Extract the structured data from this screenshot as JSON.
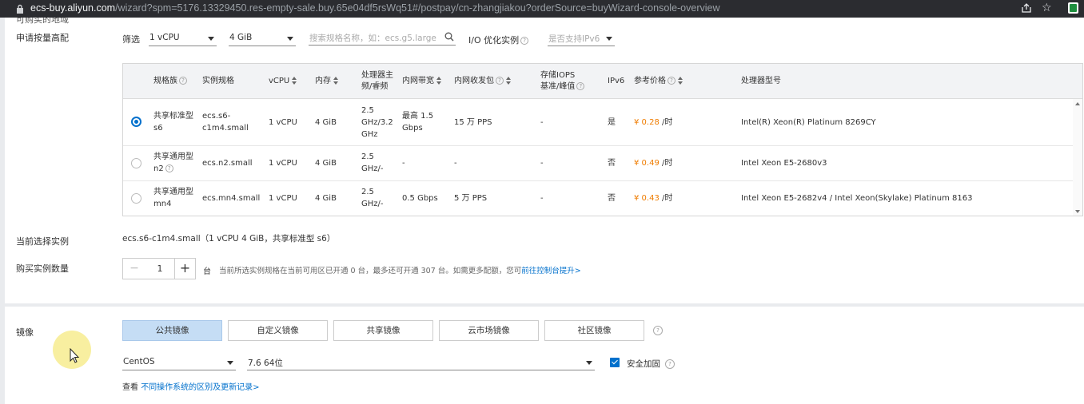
{
  "browser": {
    "url_host": "ecs-buy.aliyun.com",
    "url_path": "/wizard?spm=5176.13329450.res-empty-sale.buy.65e04df5rsWq51#/postpay/cn-zhangjiakou?orderSource=buyWizard-console-overview"
  },
  "top_cut_label": "可购买的地域",
  "filter": {
    "section_label": "申请按量高配",
    "label": "筛选",
    "vcpu_value": "1 vCPU",
    "memory_value": "4 GiB",
    "search_placeholder": "搜索规格名称，如：ecs.g5.large",
    "io_label": "I/O 优化实例",
    "ipv6_placeholder": "是否支持IPv6"
  },
  "table": {
    "headers": {
      "family": "规格族",
      "spec": "实例规格",
      "vcpu": "vCPU",
      "memory": "内存",
      "freq_line1": "处理器主",
      "freq_line2": "频/睿频",
      "bandwidth": "内网带宽",
      "pps": "内网收发包",
      "iops_line1": "存储IOPS",
      "iops_line2": "基准/峰值",
      "ipv6": "IPv6",
      "price": "参考价格",
      "cpu_model": "处理器型号"
    },
    "rows": [
      {
        "selected": true,
        "family_line1": "共享标准型",
        "family_line2": "s6",
        "spec_line1": "ecs.s6-",
        "spec_line2": "c1m4.small",
        "vcpu": "1 vCPU",
        "memory": "4 GiB",
        "freq_line1": "2.5",
        "freq_line2": "GHz/3.2",
        "freq_line3": "GHz",
        "bw_line1": "最高 1.5",
        "bw_line2": "Gbps",
        "pps": "15 万 PPS",
        "iops": "-",
        "ipv6": "是",
        "price": "¥ 0.28",
        "price_unit": " /时",
        "cpu_model": "Intel(R) Xeon(R) Platinum 8269CY"
      },
      {
        "selected": false,
        "family_line1": "共享通用型",
        "family_line2": "n2",
        "spec_line1": "ecs.n2.small",
        "spec_line2": "",
        "vcpu": "1 vCPU",
        "memory": "4 GiB",
        "freq_line1": "2.5",
        "freq_line2": "GHz/-",
        "freq_line3": "",
        "bw_line1": "-",
        "bw_line2": "",
        "pps": "-",
        "iops": "-",
        "ipv6": "否",
        "price": "¥ 0.49",
        "price_unit": " /时",
        "cpu_model": "Intel Xeon E5-2680v3"
      },
      {
        "selected": false,
        "family_line1": "共享通用型",
        "family_line2": "mn4",
        "spec_line1": "ecs.mn4.small",
        "spec_line2": "",
        "vcpu": "1 vCPU",
        "memory": "4 GiB",
        "freq_line1": "2.5",
        "freq_line2": "GHz/-",
        "freq_line3": "",
        "bw_line1": "0.5 Gbps",
        "bw_line2": "",
        "pps": "5 万 PPS",
        "iops": "-",
        "ipv6": "否",
        "price": "¥ 0.43",
        "price_unit": " /时",
        "cpu_model": "Intel Xeon E5-2682v4 / Intel Xeon(Skylake) Platinum 8163"
      }
    ]
  },
  "current": {
    "label": "当前选择实例",
    "value": "ecs.s6-c1m4.small（1 vCPU 4 GiB，共享标准型 s6）"
  },
  "quantity": {
    "label": "购买实例数量",
    "minus": "−",
    "value": "1",
    "plus": "+",
    "unit": "台",
    "hint": "当前所选实例规格在当前可用区已开通 0 台，最多还可开通 307 台。如需更多配额，您可",
    "hint_link": "前往控制台提升>"
  },
  "image": {
    "label": "镜像",
    "tabs": [
      "公共镜像",
      "自定义镜像",
      "共享镜像",
      "云市场镜像",
      "社区镜像"
    ],
    "os_value": "CentOS",
    "version_value": "7.6 64位",
    "hardening_label": "安全加固",
    "footer_prefix": "查看 ",
    "footer_link": "不同操作系统的区别及更新记录>"
  },
  "colors": {
    "accent": "#0070cc",
    "price": "#ef7c00",
    "active_tab": "#c5ddf5"
  }
}
